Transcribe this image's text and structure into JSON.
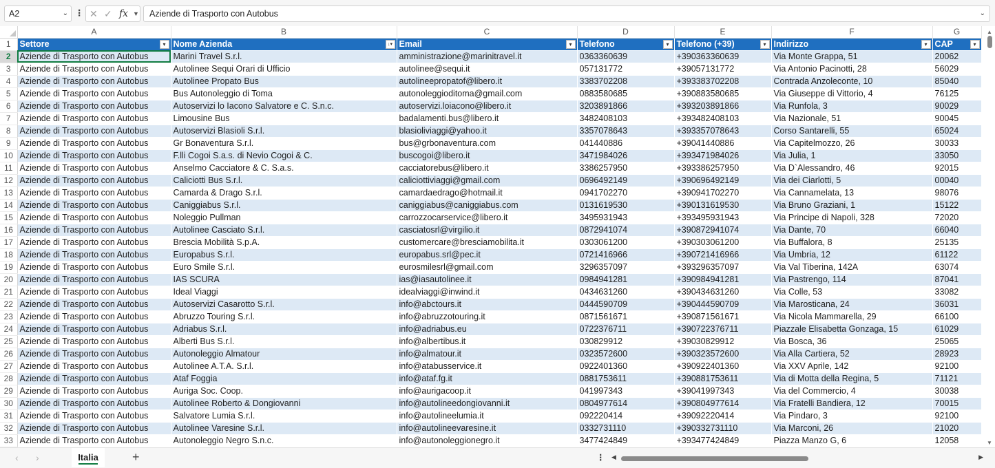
{
  "formula_bar": {
    "name_box": "A2",
    "formula": "Aziende di Trasporto con Autobus"
  },
  "columns": [
    "A",
    "B",
    "C",
    "D",
    "E",
    "F",
    "G"
  ],
  "headers": [
    "Settore",
    "Nome Azienda",
    "Email",
    "Telefono",
    "Telefono (+39)",
    "Indirizzo",
    "CAP"
  ],
  "rows": [
    [
      "Aziende di Trasporto con Autobus",
      "Marini Travel S.r.l.",
      "amministrazione@marinitravel.it",
      "0363360639",
      "+390363360639",
      "Via Monte Grappa, 51",
      "20062"
    ],
    [
      "Aziende di Trasporto con Autobus",
      "Autolinee Sequi Orari di Ufficio",
      "autolinee@sequi.it",
      "057131772",
      "+39057131772",
      "Via Antonio Pacinotti, 28",
      "56029"
    ],
    [
      "Aziende di Trasporto con Autobus",
      "Autolinee Propato Bus",
      "autolineepropatof@libero.it",
      "3383702208",
      "+393383702208",
      "Contrada Anzoleconte, 10",
      "85040"
    ],
    [
      "Aziende di Trasporto con Autobus",
      "Bus Autonoleggio di Toma",
      "autonoleggioditoma@gmail.com",
      "0883580685",
      "+390883580685",
      "Via Giuseppe di Vittorio, 4",
      "76125"
    ],
    [
      "Aziende di Trasporto con Autobus",
      "Autoservizi lo Iacono Salvatore e C. S.n.c.",
      "autoservizi.loiacono@libero.it",
      "3203891866",
      "+393203891866",
      "Via Runfola, 3",
      "90029"
    ],
    [
      "Aziende di Trasporto con Autobus",
      "Limousine Bus",
      "badalamenti.bus@libero.it",
      "3482408103",
      "+393482408103",
      "Via Nazionale, 51",
      "90045"
    ],
    [
      "Aziende di Trasporto con Autobus",
      "Autoservizi Blasioli S.r.l.",
      "blasioliviaggi@yahoo.it",
      "3357078643",
      "+393357078643",
      "Corso Santarelli, 55",
      "65024"
    ],
    [
      "Aziende di Trasporto con Autobus",
      "Gr Bonaventura S.r.l.",
      "bus@grbonaventura.com",
      "041440886",
      "+39041440886",
      "Via Capitelmozzo, 26",
      "30033"
    ],
    [
      "Aziende di Trasporto con Autobus",
      "F.lli Cogoi S.a.s. di Nevio Cogoi & C.",
      "buscogoi@libero.it",
      "3471984026",
      "+393471984026",
      "Via Julia, 1",
      "33050"
    ],
    [
      "Aziende di Trasporto con Autobus",
      "Anselmo Cacciatore & C. S.a.s.",
      "cacciatorebus@libero.it",
      "3386257950",
      "+393386257950",
      "Via D`Alessandro, 46",
      "92015"
    ],
    [
      "Aziende di Trasporto con Autobus",
      "Caliciotti Bus S.r.l.",
      "caliciottiviaggi@gmail.com",
      "0696492149",
      "+390696492149",
      "Via dei Ciarlotti, 5",
      "00040"
    ],
    [
      "Aziende di Trasporto con Autobus",
      "Camarda & Drago S.r.l.",
      "camardaedrago@hotmail.it",
      "0941702270",
      "+390941702270",
      "Via Cannamelata, 13",
      "98076"
    ],
    [
      "Aziende di Trasporto con Autobus",
      "Caniggiabus S.r.l.",
      "caniggiabus@caniggiabus.com",
      "0131619530",
      "+390131619530",
      "Via Bruno Graziani, 1",
      "15122"
    ],
    [
      "Aziende di Trasporto con Autobus",
      "Noleggio Pullman",
      "carrozzocarservice@libero.it",
      "3495931943",
      "+393495931943",
      "Via Principe di Napoli, 328",
      "72020"
    ],
    [
      "Aziende di Trasporto con Autobus",
      "Autolinee Casciato S.r.l.",
      "casciatosrl@virgilio.it",
      "0872941074",
      "+390872941074",
      "Via Dante, 70",
      "66040"
    ],
    [
      "Aziende di Trasporto con Autobus",
      "Brescia Mobilità S.p.A.",
      "customercare@bresciamobilita.it",
      "0303061200",
      "+390303061200",
      "Via Buffalora, 8",
      "25135"
    ],
    [
      "Aziende di Trasporto con Autobus",
      "Europabus S.r.l.",
      "europabus.srl@pec.it",
      "0721416966",
      "+390721416966",
      "Via Umbria, 12",
      "61122"
    ],
    [
      "Aziende di Trasporto con Autobus",
      "Euro Smile S.r.l.",
      "eurosmilesrl@gmail.com",
      "3296357097",
      "+393296357097",
      "Via Val Tiberina, 142A",
      "63074"
    ],
    [
      "Aziende di Trasporto con Autobus",
      "IAS SCURA",
      "ias@iasautolinee.it",
      "0984941281",
      "+390984941281",
      "Via Pastrengo, 114",
      "87041"
    ],
    [
      "Aziende di Trasporto con Autobus",
      "Ideal Viaggi",
      "idealviaggi@inwind.it",
      "0434631260",
      "+390434631260",
      "Via Colle, 53",
      "33082"
    ],
    [
      "Aziende di Trasporto con Autobus",
      "Autoservizi Casarotto S.r.l.",
      "info@abctours.it",
      "0444590709",
      "+390444590709",
      "Via Marosticana, 24",
      "36031"
    ],
    [
      "Aziende di Trasporto con Autobus",
      "Abruzzo Touring S.r.l.",
      "info@abruzzotouring.it",
      "0871561671",
      "+390871561671",
      "Via Nicola Mammarella, 29",
      "66100"
    ],
    [
      "Aziende di Trasporto con Autobus",
      "Adriabus S.r.l.",
      "info@adriabus.eu",
      "0722376711",
      "+390722376711",
      "Piazzale Elisabetta Gonzaga, 15",
      "61029"
    ],
    [
      "Aziende di Trasporto con Autobus",
      "Alberti Bus S.r.l.",
      "info@albertibus.it",
      "030829912",
      "+39030829912",
      "Via Bosca, 36",
      "25065"
    ],
    [
      "Aziende di Trasporto con Autobus",
      "Autonoleggio Almatour",
      "info@almatour.it",
      "0323572600",
      "+390323572600",
      "Via Alla Cartiera, 52",
      "28923"
    ],
    [
      "Aziende di Trasporto con Autobus",
      "Autolinee A.T.A. S.r.l.",
      "info@atabusservice.it",
      "0922401360",
      "+390922401360",
      "Via XXV Aprile, 142",
      "92100"
    ],
    [
      "Aziende di Trasporto con Autobus",
      "Ataf Foggia",
      "info@ataf.fg.it",
      "0881753611",
      "+390881753611",
      "Via di Motta della Regina, 5",
      "71121"
    ],
    [
      "Aziende di Trasporto con Autobus",
      "Auriga Soc. Coop.",
      "info@aurigacoop.it",
      "041997343",
      "+39041997343",
      "Via del Commercio, 4",
      "30038"
    ],
    [
      "Aziende di Trasporto con Autobus",
      "Autolinee Roberto & Dongiovanni",
      "info@autolineedongiovanni.it",
      "0804977614",
      "+390804977614",
      "Via Fratelli Bandiera, 12",
      "70015"
    ],
    [
      "Aziende di Trasporto con Autobus",
      "Salvatore Lumia S.r.l.",
      "info@autolineelumia.it",
      "092220414",
      "+39092220414",
      "Via Pindaro, 3",
      "92100"
    ],
    [
      "Aziende di Trasporto con Autobus",
      "Autolinee Varesine S.r.l.",
      "info@autolineevaresine.it",
      "0332731110",
      "+390332731110",
      "Via Marconi, 26",
      "21020"
    ],
    [
      "Aziende di Trasporto con Autobus",
      "Autonoleggio Negro S.n.c.",
      "info@autonoleggionegro.it",
      "3477424849",
      "+393477424849",
      "Piazza Manzo G, 6",
      "12058"
    ]
  ],
  "sheet_tabs": [
    "Italia"
  ],
  "colors": {
    "header_bg": "#1f6fc0",
    "band_bg": "#dde9f5",
    "accent": "#107c41"
  }
}
